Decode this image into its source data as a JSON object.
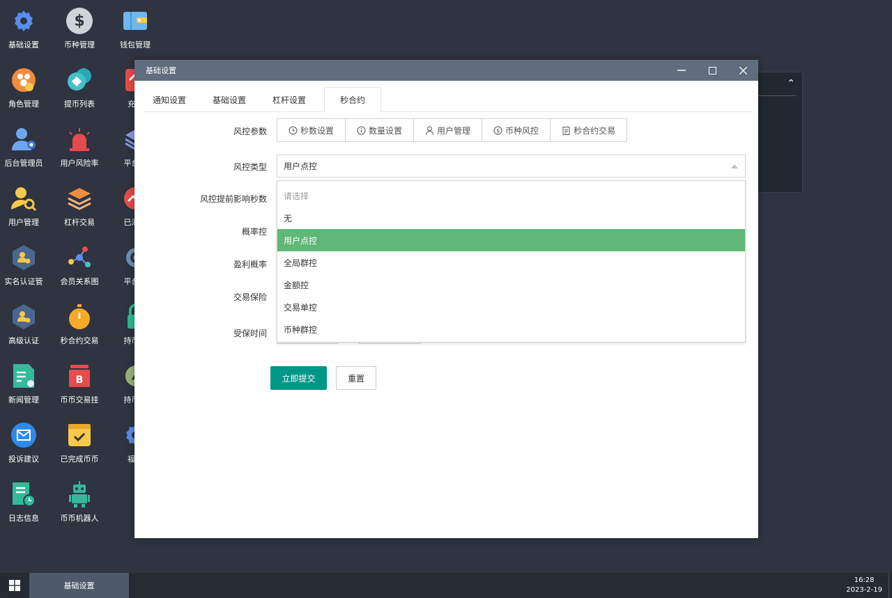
{
  "desktop": {
    "icons": [
      {
        "label": "基础设置",
        "icon": "gear-icon"
      },
      {
        "label": "币种管理",
        "icon": "dollar-icon"
      },
      {
        "label": "钱包管理",
        "icon": "wallet-icon"
      },
      {
        "label": "角色管理",
        "icon": "role-icon"
      },
      {
        "label": "提币列表",
        "icon": "withdraw-icon"
      },
      {
        "label": "充币",
        "icon": "deposit-icon"
      },
      {
        "label": "后台管理员",
        "icon": "admin-icon"
      },
      {
        "label": "用户风险率",
        "icon": "alarm-icon"
      },
      {
        "label": "平台币",
        "icon": "layers-icon"
      },
      {
        "label": "用户管理",
        "icon": "user-search-icon"
      },
      {
        "label": "杠杆交易",
        "icon": "stack-icon"
      },
      {
        "label": "已添加",
        "icon": "chart-circle-icon"
      },
      {
        "label": "实名认证管",
        "icon": "id-verify-icon"
      },
      {
        "label": "会员关系图",
        "icon": "network-icon"
      },
      {
        "label": "平台币",
        "icon": "platform-coin-icon"
      },
      {
        "label": "高级认证",
        "icon": "advanced-verify-icon"
      },
      {
        "label": "秒合约交易",
        "icon": "stopwatch-icon"
      },
      {
        "label": "持币生",
        "icon": "lock-icon"
      },
      {
        "label": "新闻管理",
        "icon": "news-icon"
      },
      {
        "label": "币币交易挂",
        "icon": "bitcoin-box-icon"
      },
      {
        "label": "持币生",
        "icon": "leaf-icon"
      },
      {
        "label": "投诉建议",
        "icon": "mail-icon"
      },
      {
        "label": "已完成币币",
        "icon": "check-box-icon"
      },
      {
        "label": "福利",
        "icon": "gear-icon"
      },
      {
        "label": "日志信息",
        "icon": "log-icon"
      },
      {
        "label": "币币机器人",
        "icon": "robot-icon"
      }
    ]
  },
  "window": {
    "title": "基础设置",
    "tabs": [
      {
        "label": "通知设置"
      },
      {
        "label": "基础设置"
      },
      {
        "label": "杠杆设置"
      },
      {
        "label": "秒合约"
      }
    ],
    "form": {
      "risk_params_label": "风控参数",
      "risk_buttons": [
        {
          "label": "秒数设置",
          "icon": "clock-icon"
        },
        {
          "label": "数量设置",
          "icon": "info-icon"
        },
        {
          "label": "用户管理",
          "icon": "user-icon"
        },
        {
          "label": "币种风控",
          "icon": "coin-icon"
        },
        {
          "label": "秒合约交易",
          "icon": "clipboard-icon"
        }
      ],
      "risk_type_label": "风控类型",
      "risk_type_value": "用户点控",
      "advance_seconds_label": "风控提前影响秒数",
      "probability_label": "概率控",
      "profit_rate_label": "盈利概率",
      "insurance_label": "交易保险",
      "insured_time_label": "受保时间",
      "dropdown_options": [
        {
          "label": "请选择",
          "placeholder": true
        },
        {
          "label": "无"
        },
        {
          "label": "用户点控",
          "selected": true
        },
        {
          "label": "全局群控"
        },
        {
          "label": "金额控"
        },
        {
          "label": "交易单控"
        },
        {
          "label": "币种群控"
        }
      ],
      "submit_label": "立即提交",
      "reset_label": "重置"
    }
  },
  "taskbar": {
    "task_label": "基础设置",
    "time": "16:28",
    "date": "2023-2-19"
  },
  "colors": {
    "accent": "#009688",
    "selected_option": "#5fb878",
    "titlebar": "#5f6d7e",
    "desktop": "#2f3440"
  }
}
